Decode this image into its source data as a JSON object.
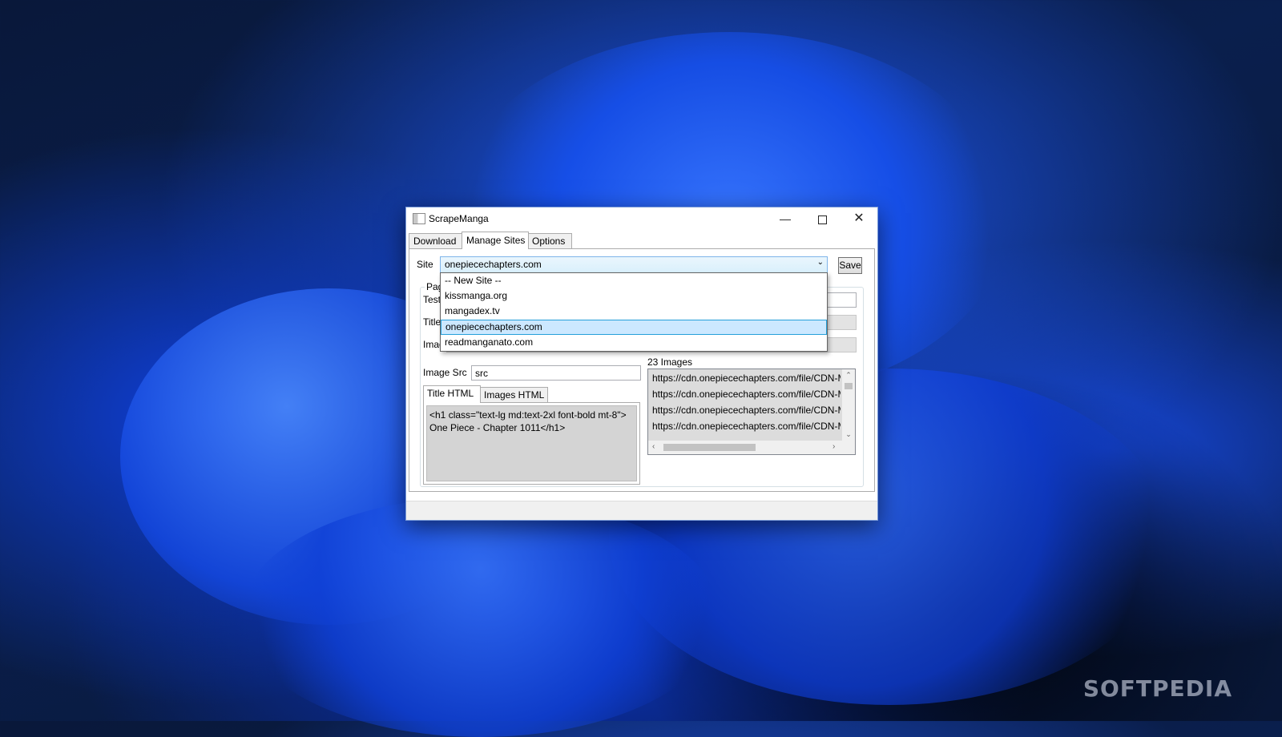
{
  "window": {
    "title": "ScrapeManga",
    "minimize_glyph": "—",
    "close_glyph": "✕"
  },
  "tabs": [
    {
      "label": "Download"
    },
    {
      "label": "Manage Sites"
    },
    {
      "label": "Options"
    }
  ],
  "manage_sites": {
    "site_label": "Site",
    "site_selected": "onepiecechapters.com",
    "save_label": "Save",
    "group_legend": "Page",
    "test_label": "Test",
    "title_label": "Title",
    "images_label": "Imag",
    "image_src_label": "Image Src",
    "image_src_value": "src",
    "inner_tabs": [
      {
        "label": "Title HTML"
      },
      {
        "label": "Images HTML"
      }
    ],
    "title_html": "<h1 class=\"text-lg md:text-2xl font-bold mt-8\">One Piece - Chapter 1011</h1>",
    "images_count": "23 Images",
    "images": [
      "https://cdn.onepiecechapters.com/file/CDN-M",
      "https://cdn.onepiecechapters.com/file/CDN-M",
      "https://cdn.onepiecechapters.com/file/CDN-M",
      "https://cdn.onepiecechapters.com/file/CDN-M"
    ]
  },
  "dropdown": {
    "options": [
      "-- New Site --",
      "kissmanga.org",
      "mangadex.tv",
      "onepiecechapters.com",
      "readmanganato.com"
    ],
    "selected_index": 3
  },
  "watermark": "SOFTPEDIA",
  "icons": {
    "app": "app-icon",
    "combo_arrow": "chevron-down-icon",
    "scroll_up": "scroll-up-icon",
    "scroll_down": "scroll-down-icon",
    "scroll_left": "scroll-left-icon",
    "scroll_right": "scroll-right-icon"
  },
  "colors": {
    "selection_bg": "#cce8ff",
    "selection_border": "#26a0da",
    "combo_border": "#7eb4ea",
    "readonly_bg": "#d4d4d4"
  }
}
